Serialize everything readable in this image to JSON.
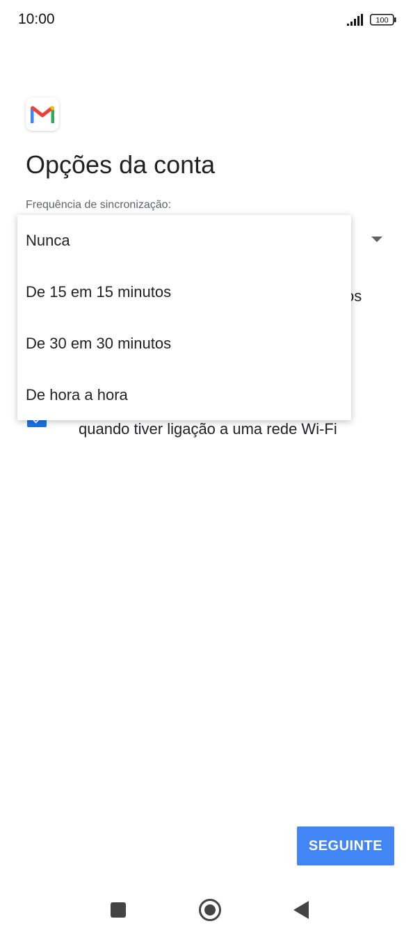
{
  "status_bar": {
    "time": "10:00",
    "battery": "100",
    "signal_icon": "signal-icon",
    "battery_icon": "battery-icon"
  },
  "app": {
    "logo_icon": "gmail-logo-icon"
  },
  "page": {
    "title": "Opções da conta",
    "sync_label": "Frequência de sincronização:",
    "partial_text_right": "os",
    "wifi_option_text": "quando tiver ligação a uma rede Wi-Fi"
  },
  "dropdown_menu": {
    "options": [
      "Nunca",
      "De 15 em 15 minutos",
      "De 30 em 30 minutos",
      "De hora a hora"
    ]
  },
  "actions": {
    "next_label": "SEGUINTE"
  },
  "colors": {
    "accent": "#4285f4",
    "checkbox": "#1a73e8",
    "text": "#202124",
    "secondary_text": "#5f6368"
  }
}
